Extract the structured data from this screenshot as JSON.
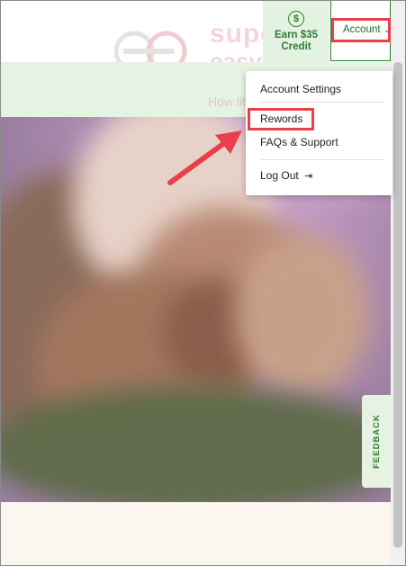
{
  "header": {
    "earn_button": {
      "label": "Earn $35 Credit",
      "icon_glyph": "$"
    },
    "account_button": {
      "label": "Account",
      "chevron": "⌄"
    }
  },
  "watermark": {
    "line1": "super",
    "line2": "easy",
    "tagline": "How life should be"
  },
  "account_menu": {
    "items": [
      {
        "label": "Account Settings"
      },
      {
        "label": "Rewords"
      },
      {
        "label": "FAQs & Support"
      },
      {
        "label": "Log Out",
        "icon": "logout-icon",
        "icon_glyph": "⇥"
      }
    ]
  },
  "feedback_tab": {
    "label": "FEEDBACK"
  },
  "colors": {
    "highlight": "#ea3f4a",
    "brand_green": "#2e7d32",
    "band_green": "#e6f3e3"
  }
}
